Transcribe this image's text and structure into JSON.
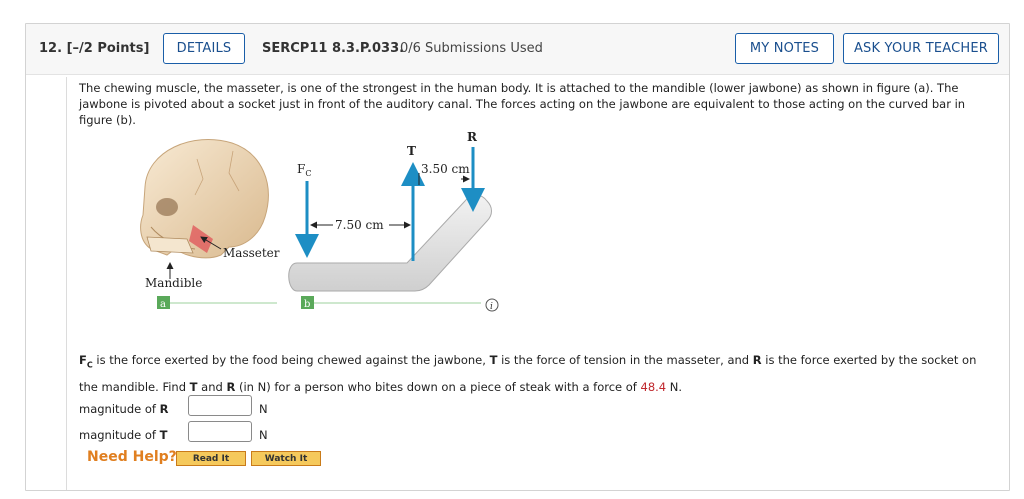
{
  "header": {
    "question_number": "12.",
    "points": "[–/2 Points]",
    "details_label": "DETAILS",
    "question_id": "SERCP11 8.3.P.033.",
    "submissions": "0/6 Submissions Used",
    "my_notes_label": "MY NOTES",
    "ask_teacher_label": "ASK YOUR TEACHER"
  },
  "intro": "The chewing muscle, the masseter, is one of the strongest in the human body. It is attached to the mandible (lower jawbone) as shown in figure (a). The jawbone is pivoted about a socket just in front of the auditory canal. The forces acting on the jawbone are equivalent to those acting on the curved bar in figure (b).",
  "figure": {
    "label_masseter": "Masseter",
    "label_mandible": "Mandible",
    "label_fc": "F",
    "label_fc_sub": "C",
    "label_t": "T",
    "label_r": "R",
    "dim_left": "7.50 cm",
    "dim_right": "3.50 cm",
    "tag_a": "a",
    "tag_b": "b",
    "info_icon": "i"
  },
  "question": {
    "fc": "F",
    "fc_sub": "C",
    "part1": " is the force exerted by the food being chewed against the jawbone, ",
    "t": "T",
    "part2": " is the force of tension in the masseter, and ",
    "r": "R",
    "part3": " is the force exerted by the socket on the mandible. Find ",
    "part4": " and ",
    "part5": " (in N) for a person who bites down on a piece of steak with a force of ",
    "force_value": "48.4",
    "part6": " N."
  },
  "answers": [
    {
      "label": "magnitude of ",
      "symbol": "R",
      "unit": "N",
      "value": ""
    },
    {
      "label": "magnitude of ",
      "symbol": "T",
      "unit": "N",
      "value": ""
    }
  ],
  "help": {
    "label": "Need Help?",
    "read_it": "Read It",
    "watch_it": "Watch It"
  },
  "colors": {
    "accent_blue": "#1a5ea8",
    "arrow_blue": "#1d8ec4",
    "highlight_red": "#c0282d",
    "help_orange": "#e07f20"
  }
}
